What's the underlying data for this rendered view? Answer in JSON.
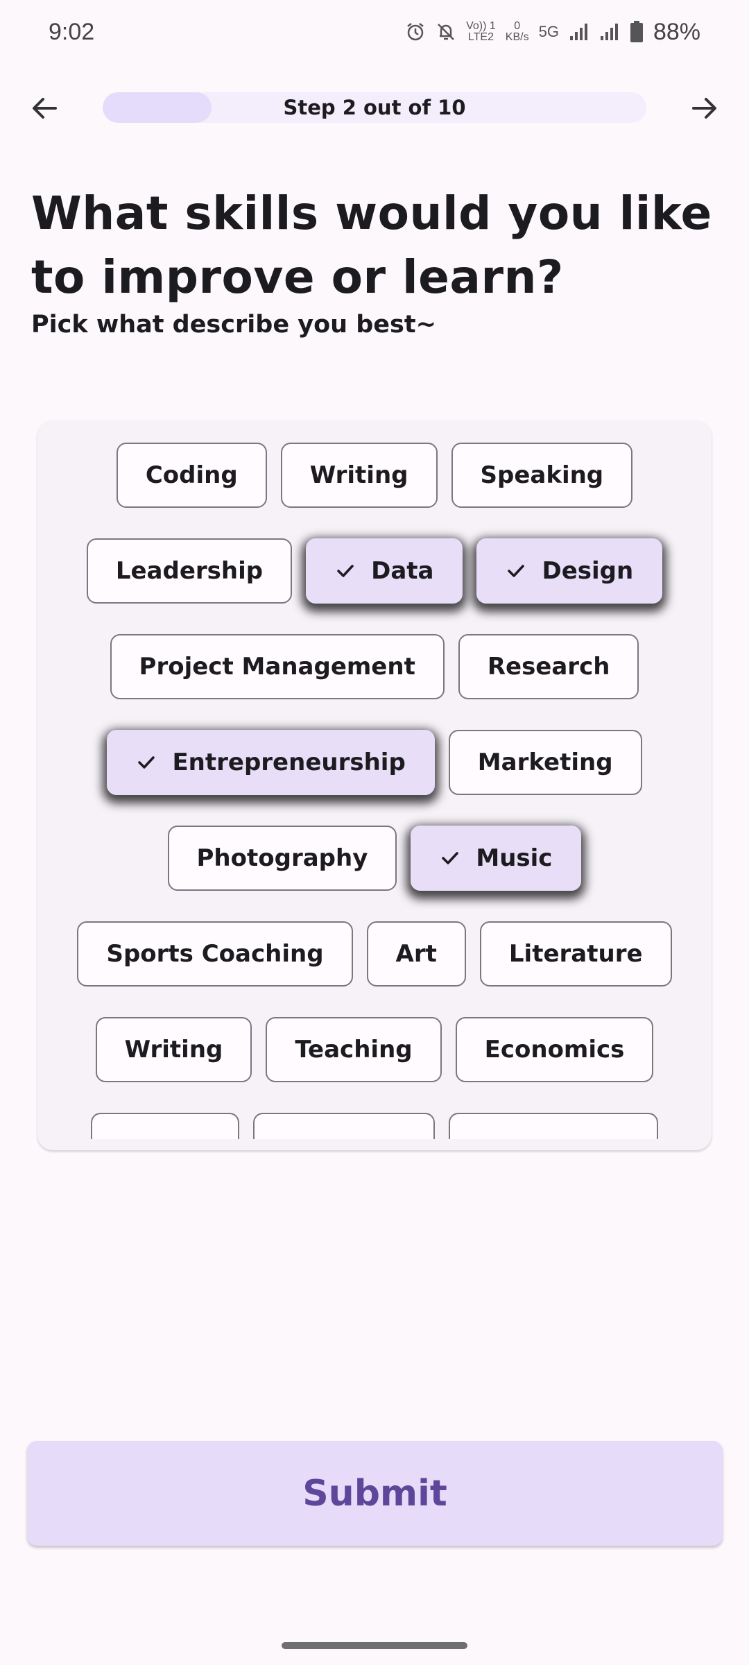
{
  "status_bar": {
    "time": "9:02",
    "volte_top": "Vo)) 1",
    "volte_bottom": "LTE2",
    "net_speed_top": "0",
    "net_speed_bottom": "KB/s",
    "network": "5G",
    "battery": "88%",
    "icons": [
      "alarm-icon",
      "mute-icon",
      "signal-icon",
      "signal-icon",
      "battery-icon"
    ]
  },
  "nav": {
    "back_icon": "arrow-left-icon",
    "next_icon": "arrow-right-icon",
    "progress_label": "Step 2 out of 10",
    "progress_value": 0.2
  },
  "heading": "What skills would you like to improve or learn?",
  "subheading": "Pick what describe you best~",
  "chips": {
    "check_icon": "check-icon",
    "rows": [
      [
        {
          "label": "Coding",
          "selected": false
        },
        {
          "label": "Writing",
          "selected": false
        },
        {
          "label": "Speaking",
          "selected": false
        }
      ],
      [
        {
          "label": "Leadership",
          "selected": false
        },
        {
          "label": "Data",
          "selected": true
        },
        {
          "label": "Design",
          "selected": true
        }
      ],
      [
        {
          "label": "Project Management",
          "selected": false
        },
        {
          "label": "Research",
          "selected": false
        }
      ],
      [
        {
          "label": "Entrepreneurship",
          "selected": true
        },
        {
          "label": "Marketing",
          "selected": false
        }
      ],
      [
        {
          "label": "Photography",
          "selected": false
        },
        {
          "label": "Music",
          "selected": true
        }
      ],
      [
        {
          "label": "Sports Coaching",
          "selected": false
        },
        {
          "label": "Art",
          "selected": false
        },
        {
          "label": "Literature",
          "selected": false
        }
      ],
      [
        {
          "label": "Writing",
          "selected": false
        },
        {
          "label": "Teaching",
          "selected": false
        },
        {
          "label": "Economics",
          "selected": false
        }
      ]
    ]
  },
  "submit_label": "Submit",
  "colors": {
    "background": "#fdf8fc",
    "chip_selected": "#e8def8",
    "submit_bg": "#e6dbf8",
    "submit_text": "#5e479a",
    "progress_fill": "#e5dbfa"
  }
}
